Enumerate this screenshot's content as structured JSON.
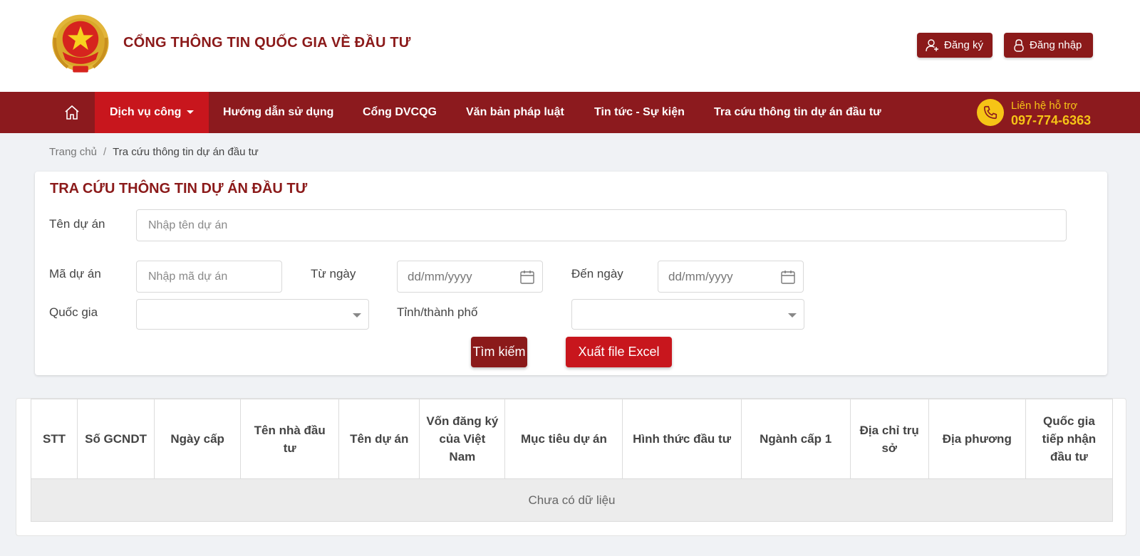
{
  "header": {
    "site_title": "CỔNG THÔNG TIN QUỐC GIA VỀ ĐẦU TƯ",
    "register_label": "Đăng ký",
    "login_label": "Đăng nhập"
  },
  "nav": {
    "items": [
      {
        "label": "Dịch vụ công",
        "active": true
      },
      {
        "label": "Hướng dẫn sử dụng"
      },
      {
        "label": "Cổng DVCQG"
      },
      {
        "label": "Văn bản pháp luật"
      },
      {
        "label": "Tin tức - Sự kiện"
      },
      {
        "label": "Tra cứu thông tin dự án đầu tư"
      }
    ],
    "hotline_label": "Liên hệ hỗ trợ",
    "hotline_number": "097-774-6363"
  },
  "breadcrumb": {
    "home": "Trang chủ",
    "current": "Tra cứu thông tin dự án đầu tư"
  },
  "search": {
    "title": "TRA CỨU THÔNG TIN DỰ ÁN ĐẦU TƯ",
    "project_name_label": "Tên dự án",
    "project_name_placeholder": "Nhập tên dự án",
    "project_code_label": "Mã dự án",
    "project_code_placeholder": "Nhập mã dự án",
    "from_date_label": "Từ ngày",
    "to_date_label": "Đến ngày",
    "date_placeholder": "dd/mm/yyyy",
    "country_label": "Quốc gia",
    "country_value": "",
    "province_label": "Tỉnh/thành phố",
    "province_value": "",
    "search_button": "Tìm kiếm",
    "export_button": "Xuất file Excel"
  },
  "table": {
    "columns": [
      "STT",
      "Số GCNDT",
      "Ngày cấp",
      "Tên nhà đầu tư",
      "Tên dự án",
      "Vốn đăng ký của Việt Nam",
      "Mục tiêu dự án",
      "Hình thức đầu tư",
      "Ngành cấp 1",
      "Địa chỉ trụ sở",
      "Địa phương",
      "Quốc gia tiếp nhận đầu tư"
    ],
    "empty_text": "Chưa có dữ liệu"
  },
  "colors": {
    "brand_dark": "#8b1a1a",
    "brand_red": "#c8161d",
    "hotline_yellow": "#f6c416"
  }
}
